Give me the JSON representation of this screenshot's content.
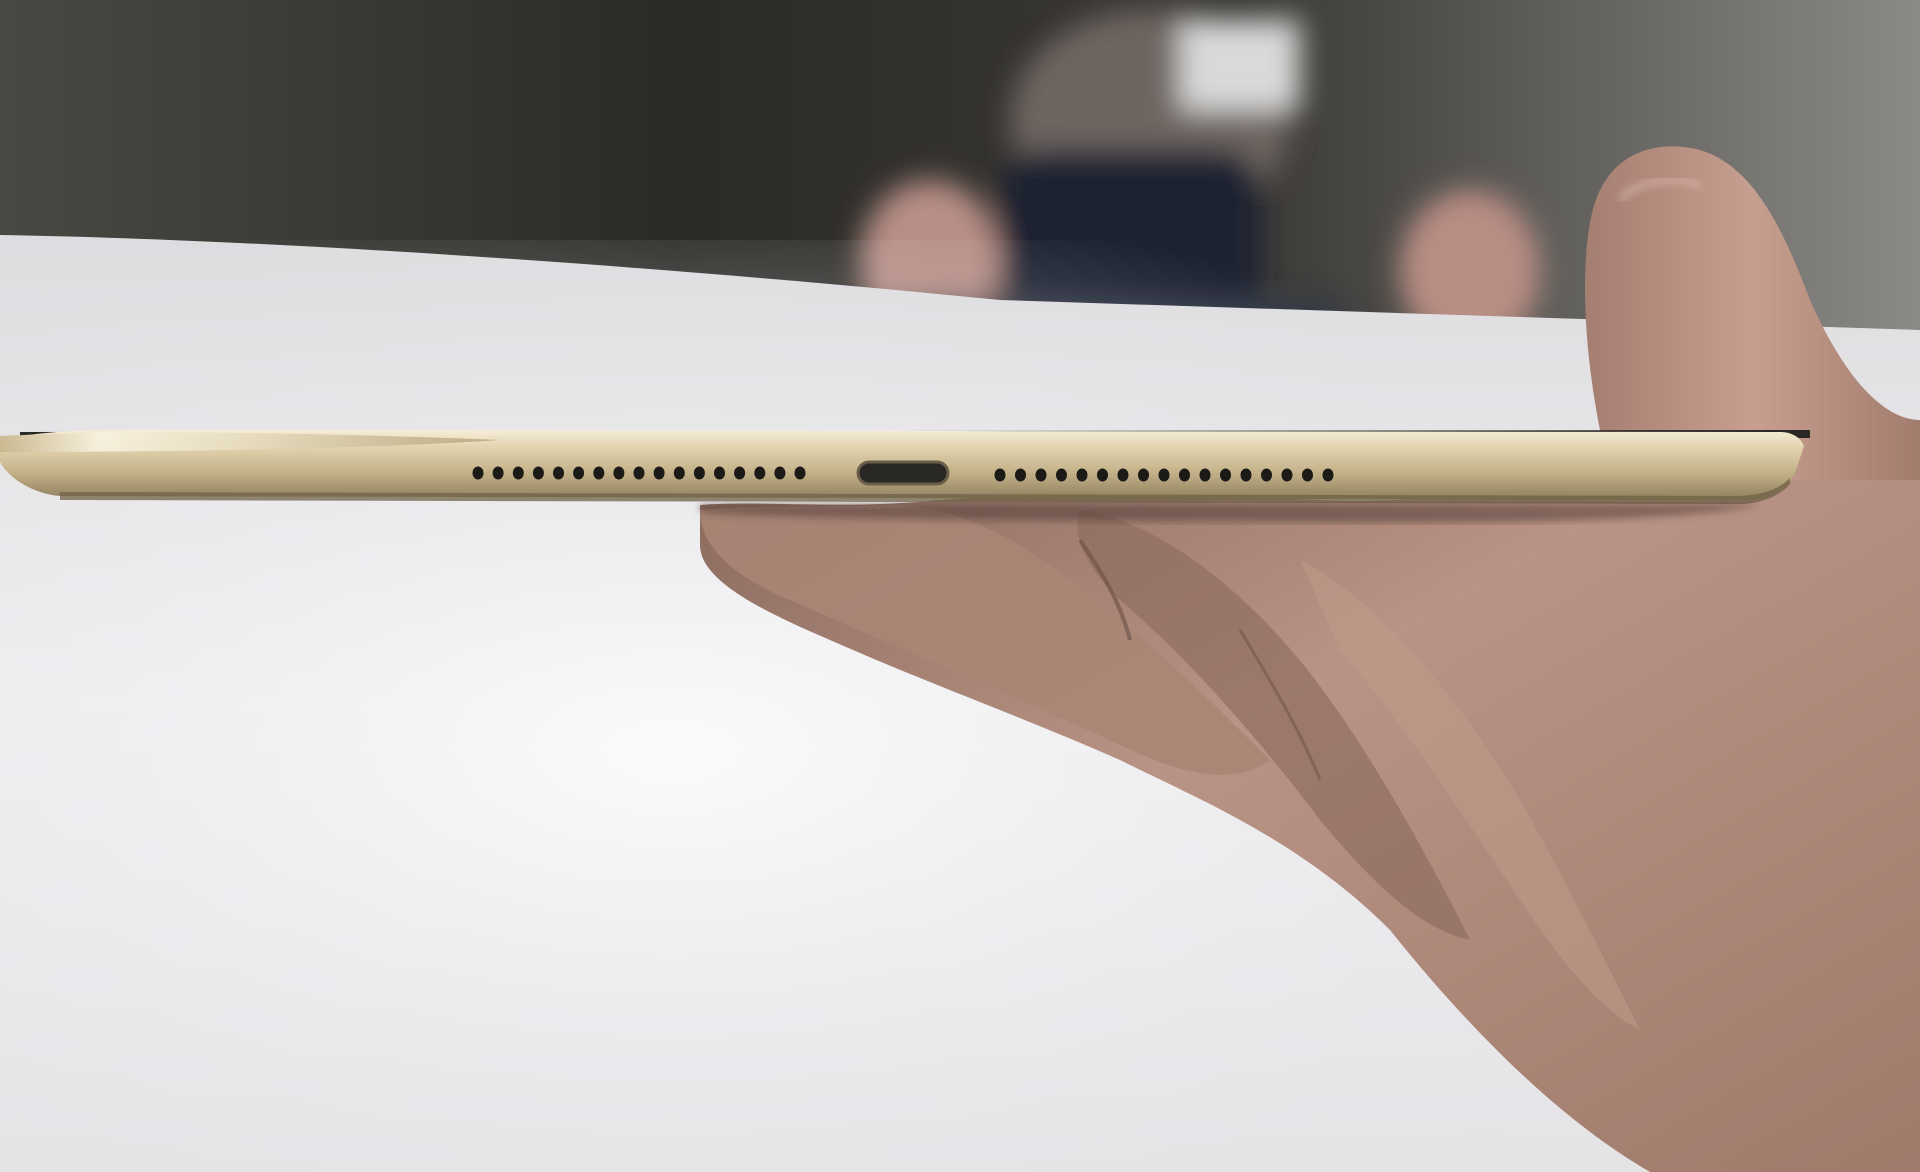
{
  "scene": {
    "subject": "tablet-bottom-edge-held-in-hand",
    "colors": {
      "table_surface": "#ecebee",
      "background_wall": "#3a3835",
      "tablet_frame_gold": "#c9b892",
      "tablet_highlight": "#f4ecd6",
      "tablet_shadow": "#8a7a58",
      "speaker_holes": "#1c1a17",
      "port": "#2a2824",
      "skin": "#b08a78",
      "skin_shadow": "#6e5246"
    },
    "speaker_grille": {
      "left_hole_count": 17,
      "right_hole_count": 17
    }
  }
}
